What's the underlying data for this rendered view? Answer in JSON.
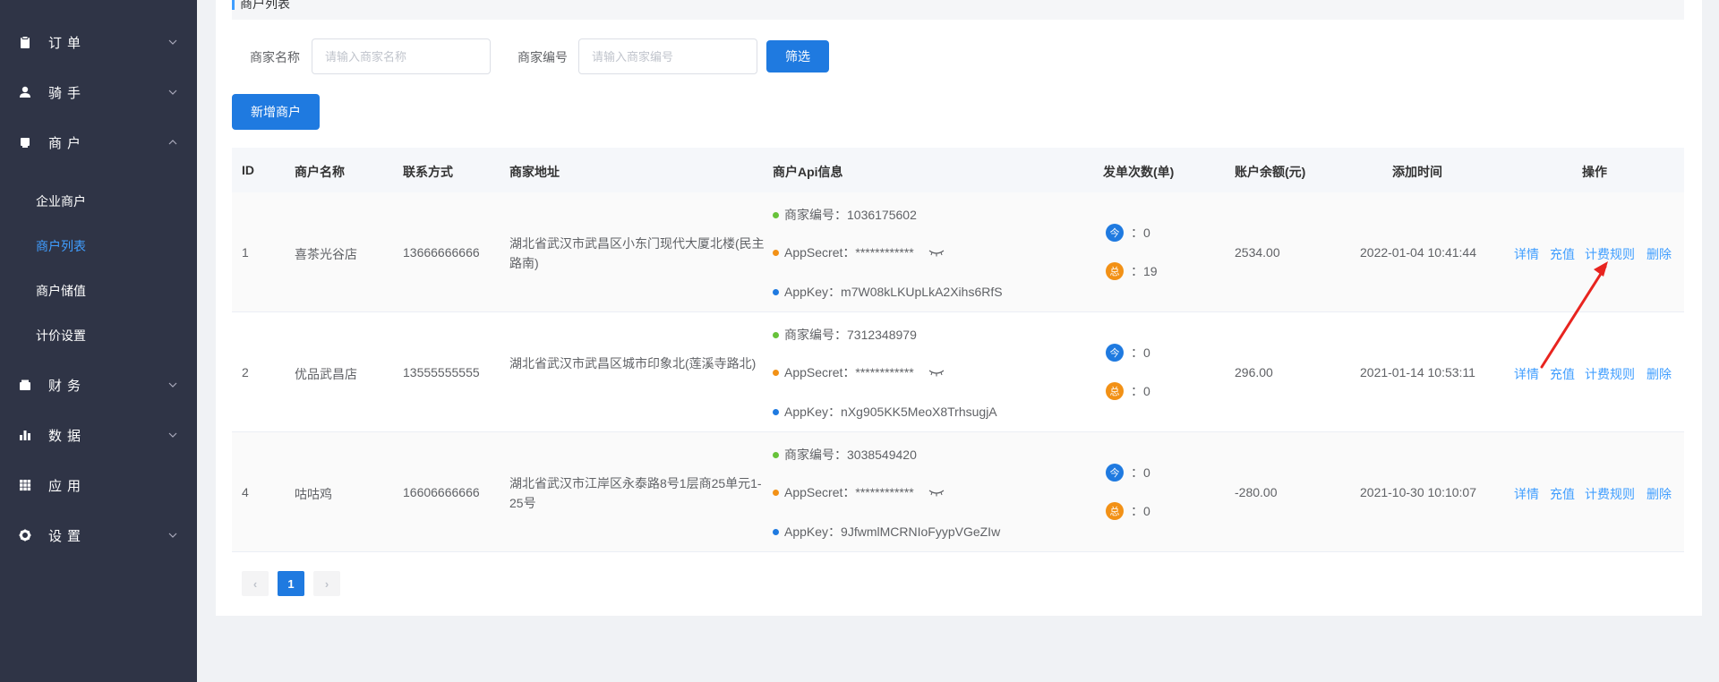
{
  "sidebar": {
    "menu": [
      {
        "label": "订单",
        "icon": "clipboard-icon",
        "expanded": false
      },
      {
        "label": "骑手",
        "icon": "user-icon",
        "expanded": false
      },
      {
        "label": "商户",
        "icon": "shop-icon",
        "expanded": true
      },
      {
        "label": "财务",
        "icon": "wallet-icon",
        "expanded": false
      },
      {
        "label": "数据",
        "icon": "bar-chart-icon",
        "expanded": false
      },
      {
        "label": "应用",
        "icon": "grid-icon",
        "expanded": false
      },
      {
        "label": "设置",
        "icon": "gear-icon",
        "expanded": false
      }
    ],
    "submenu": [
      {
        "label": "企业商户",
        "active": false
      },
      {
        "label": "商户列表",
        "active": true
      },
      {
        "label": "商户储值",
        "active": false
      },
      {
        "label": "计价设置",
        "active": false
      }
    ]
  },
  "page": {
    "title": "商户列表"
  },
  "filters": {
    "name_label": "商家名称",
    "name_placeholder": "请输入商家名称",
    "code_label": "商家编号",
    "code_placeholder": "请输入商家编号",
    "filter_button": "筛选"
  },
  "add_button": "新增商户",
  "table": {
    "headers": {
      "id": "ID",
      "name": "商户名称",
      "contact": "联系方式",
      "address": "商家地址",
      "api": "商户Api信息",
      "orders": "发单次数(单)",
      "balance": "账户余额(元)",
      "created": "添加时间",
      "actions": "操作"
    },
    "api_labels": {
      "merchant_no": "商家编号：",
      "secret": "AppSecret：",
      "key": "AppKey："
    },
    "badges": {
      "today": "今",
      "total": "总"
    },
    "actions": [
      "详情",
      "充值",
      "计费规则",
      "删除"
    ],
    "rows": [
      {
        "id": "1",
        "name": "喜茶光谷店",
        "contact": "13666666666",
        "address": "湖北省武汉市武昌区小东门现代大厦北楼(民主路南)",
        "merchant_no": "1036175602",
        "secret": "************",
        "key": "m7W08kLKUpLkA2Xihs6RfS",
        "today": "：0",
        "total": "：19",
        "balance": "2534.00",
        "created": "2022-01-04 10:41:44"
      },
      {
        "id": "2",
        "name": "优品武昌店",
        "contact": "13555555555",
        "address": "湖北省武汉市武昌区城市印象北(莲溪寺路北)",
        "merchant_no": "7312348979",
        "secret": "************",
        "key": "nXg905KK5MeoX8TrhsugjA",
        "today": "：0",
        "total": "：0",
        "balance": "296.00",
        "created": "2021-01-14 10:53:11"
      },
      {
        "id": "4",
        "name": "咕咕鸡",
        "contact": "16606666666",
        "address": "湖北省武汉市江岸区永泰路8号1层商25单元1-25号",
        "merchant_no": "3038549420",
        "secret": "************",
        "key": "9JfwmlMCRNIoFyypVGeZIw",
        "today": "：0",
        "total": "：0",
        "balance": "-280.00",
        "created": "2021-10-30 10:10:07"
      }
    ]
  },
  "pagination": {
    "prev": "‹",
    "current": "1",
    "next": "›"
  },
  "colors": {
    "sidebar_bg": "#2f3446",
    "accent": "#1f7ae0",
    "link": "#409eff",
    "dot_green": "#67c23a",
    "dot_orange": "#f29116",
    "dot_blue": "#1f7ae0",
    "annotation_red": "#e8241f"
  }
}
